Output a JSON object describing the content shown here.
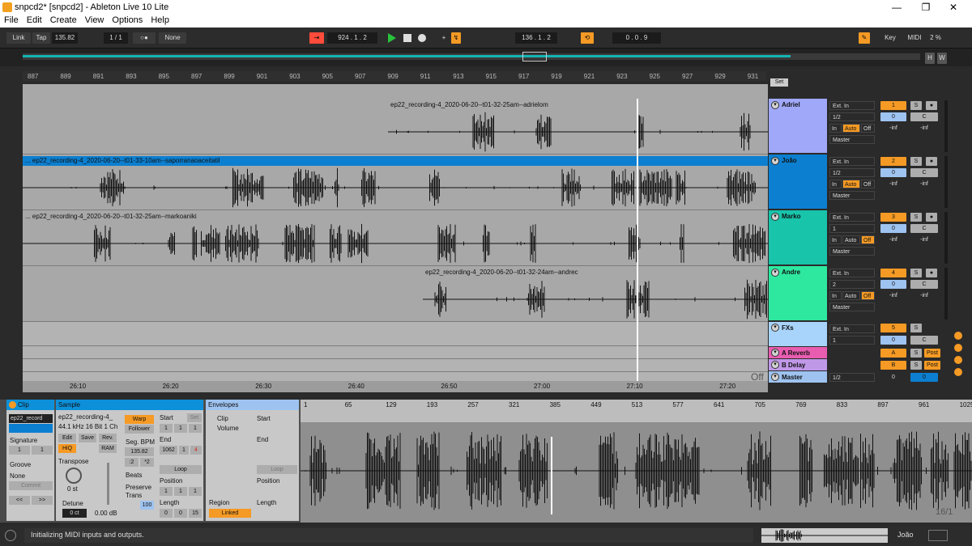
{
  "window": {
    "title": "snpcd2*  [snpcd2] - Ableton Live 10 Lite",
    "min": "—",
    "max": "❐",
    "close": "✕"
  },
  "menu": [
    "File",
    "Edit",
    "Create",
    "View",
    "Options",
    "Help"
  ],
  "control": {
    "link": "Link",
    "tap": "Tap",
    "bpm": "135.82",
    "sig": "1 / 1",
    "metro": "○●",
    "quant": "None",
    "arr_pos": "924 .  1 .  2",
    "loop_start": "136 .  1 .  2",
    "loop_len": "0 .  0 .  9",
    "key": "Key",
    "midi": "MIDI",
    "cpu": "2 %"
  },
  "ruler": [
    "887",
    "889",
    "891",
    "893",
    "895",
    "897",
    "899",
    "901",
    "903",
    "905",
    "907",
    "909",
    "911",
    "913",
    "915",
    "917",
    "919",
    "921",
    "923",
    "925",
    "927",
    "929",
    "931"
  ],
  "set_label": "Set",
  "clips": [
    {
      "name": "ep22_recording-4_2020-06-20--t01-32-25am--adrielom",
      "color": "#a0a8fa"
    },
    {
      "name": "... ep22_recording-4_2020-06-20--t01-33-10am--saporranaoaceitatil",
      "color": "#a5aeb6"
    },
    {
      "name": "... ep22_recording-4_2020-06-20--t01-32-25am--markoaniki",
      "color": "#18c4aa"
    },
    {
      "name": "ep22_recording-4_2020-06-20--t01-32-24am--andrec",
      "color": "#2ee8a0"
    }
  ],
  "tracks": [
    {
      "name": "Adriel",
      "color": "#a0a8fa",
      "input": "Ext. In",
      "ch": "1/2",
      "num": "1",
      "vol": "0",
      "pan": "C",
      "m1": "-inf",
      "m2": "-inf"
    },
    {
      "name": "João",
      "color": "#0c7fd0",
      "input": "Ext. In",
      "ch": "1/2",
      "num": "2",
      "vol": "0",
      "pan": "C",
      "m1": "-inf",
      "m2": "-inf"
    },
    {
      "name": "Marko",
      "color": "#18c4aa",
      "input": "Ext. In",
      "ch": "1",
      "num": "3",
      "vol": "0",
      "pan": "C",
      "m1": "-inf",
      "m2": "-inf"
    },
    {
      "name": "Andre",
      "color": "#2ee8a0",
      "input": "Ext. In",
      "ch": "2",
      "num": "4",
      "vol": "0",
      "pan": "C",
      "m1": "-inf",
      "m2": "-inf"
    }
  ],
  "monitor": {
    "in": "In",
    "auto": "Auto",
    "off": "Off"
  },
  "returns": [
    {
      "name": "FXs",
      "color": "#a8d4fb",
      "input": "Ext. In",
      "ch": "1",
      "num": "5",
      "vol": "0",
      "pan": "C"
    },
    {
      "name": "A Reverb",
      "color": "#e85db0",
      "num": "A",
      "post": "Post"
    },
    {
      "name": "B Delay",
      "color": "#c098e8",
      "num": "B",
      "post": "Post"
    },
    {
      "name": "Master",
      "color": "#9ec3f0",
      "ch": "1/2",
      "vol": "0",
      "num": "0"
    }
  ],
  "solo": "S",
  "timeline": [
    "26:10",
    "26:20",
    "26:30",
    "26:40",
    "26:50",
    "27:00",
    "27:10",
    "27:20"
  ],
  "off_label": "Off",
  "detail": {
    "clip": {
      "title": "Clip",
      "name": "ep22_record",
      "sig_label": "Signature",
      "sig_n": "1",
      "sig_d": "1",
      "groove": "Groove",
      "groove_val": "None",
      "commit": "Commit",
      "prev": "<<",
      "next": ">>"
    },
    "sample": {
      "title": "Sample",
      "file": "ep22_recording-4_",
      "info": "44.1 kHz 16 Bit 1 Ch",
      "edit": "Edit",
      "save": "Save",
      "rev": "Rev.",
      "hiq": "HiQ",
      "ram": "RAM",
      "transpose": "Transpose",
      "transpose_val": "0 st",
      "detune": "Detune",
      "detune_val": "0 ct",
      "gain": "0.00 dB",
      "warp": "Warp",
      "follower": "Follower",
      "seg_bpm": "Seg. BPM",
      "seg_val": "135.82",
      "half": ":2",
      "dbl": "*2",
      "beats": "Beats",
      "preserve": "Preserve",
      "trans": "Trans",
      "trans_val": "100",
      "start": "Start",
      "set": "Set",
      "start_v": [
        "1",
        "1",
        "1"
      ],
      "end": "End",
      "end_v": [
        "1062",
        "1",
        "4"
      ],
      "loop": "Loop",
      "position": "Position",
      "pos_v": [
        "1",
        "1",
        "1"
      ],
      "length": "Length",
      "len_v": [
        "0",
        "0",
        "15"
      ]
    },
    "env": {
      "title": "Envelopes",
      "clip": "Clip",
      "vol": "Volume",
      "start": "Start",
      "end": "End",
      "loop": "Loop",
      "position": "Position",
      "length": "Length",
      "region": "Region",
      "linked": "Linked"
    },
    "ruler": [
      "1",
      "65",
      "129",
      "193",
      "257",
      "321",
      "385",
      "449",
      "513",
      "577",
      "641",
      "705",
      "769",
      "833",
      "897",
      "961",
      "1025"
    ],
    "page": "16/1"
  },
  "status": {
    "msg": "Initializing MIDI inputs and outputs.",
    "track": "João"
  }
}
